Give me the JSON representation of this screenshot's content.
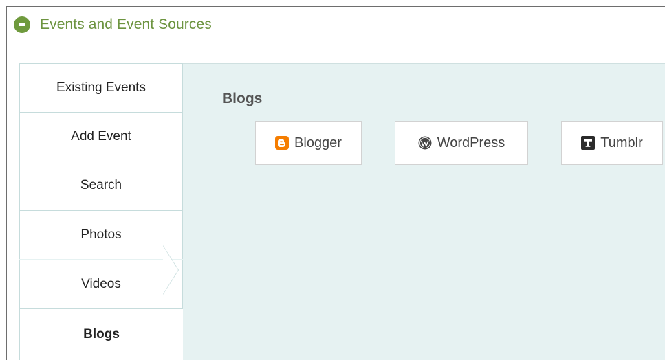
{
  "header": {
    "title": "Events and Event Sources",
    "collapse_icon": "collapse-minus-icon",
    "accent_color": "#6d9440"
  },
  "sidebar": {
    "items": [
      {
        "label": "Existing Events"
      },
      {
        "label": "Add Event"
      },
      {
        "label": "Search"
      },
      {
        "label": "Photos"
      },
      {
        "label": "Videos"
      },
      {
        "label": "Blogs",
        "active": true
      }
    ]
  },
  "content": {
    "section_title": "Blogs",
    "sources": [
      {
        "label": "Blogger",
        "icon": "blogger-icon",
        "color": "#f57d00"
      },
      {
        "label": "WordPress",
        "icon": "wordpress-icon",
        "color": "#464646"
      },
      {
        "label": "Tumblr",
        "icon": "tumblr-icon",
        "color": "#2b2b2b"
      }
    ]
  }
}
